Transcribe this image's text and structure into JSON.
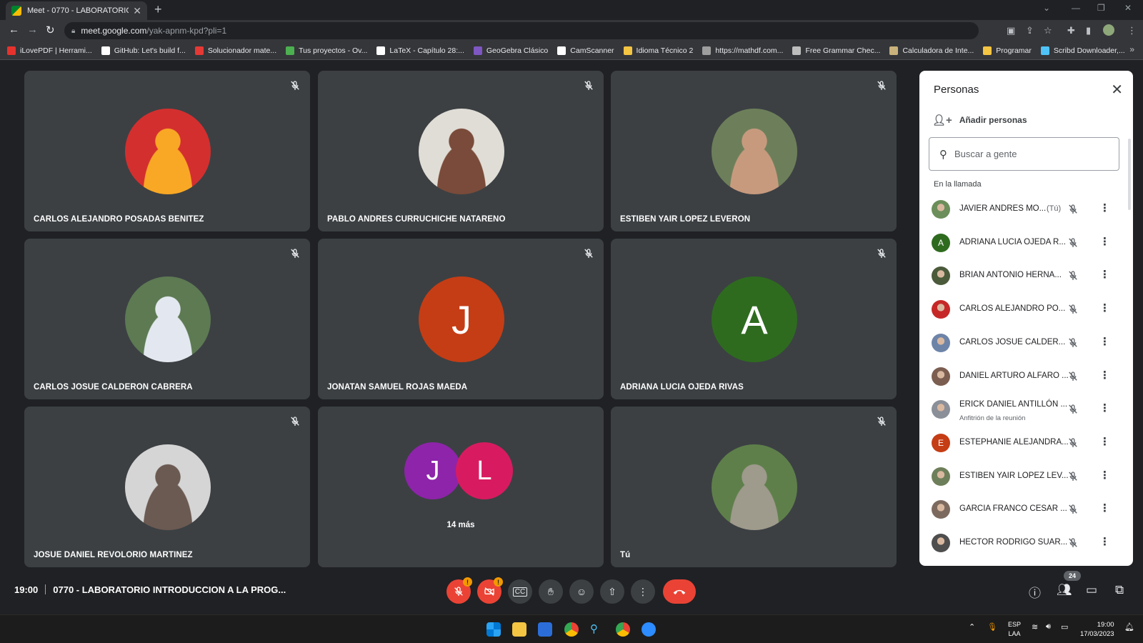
{
  "browser": {
    "tab_title": "Meet - 0770 - LABORATORIO INT",
    "url_host": "meet.google.com",
    "url_path": "/yak-apnm-kpd?pli=1",
    "bookmarks": [
      {
        "label": "iLovePDF | Herrami...",
        "color": "#e5322d"
      },
      {
        "label": "GitHub: Let's build f...",
        "color": "#ffffff"
      },
      {
        "label": "Solucionador mate...",
        "color": "#e53935"
      },
      {
        "label": "Tus proyectos - Ov...",
        "color": "#4caf50"
      },
      {
        "label": "LaTeX - Capítulo 28:...",
        "color": "#ffffff"
      },
      {
        "label": "GeoGebra Clásico",
        "color": "#7e57c2"
      },
      {
        "label": "CamScanner",
        "color": "#ffffff"
      },
      {
        "label": "Idioma Técnico 2",
        "color": "#f4c542"
      },
      {
        "label": "https://mathdf.com...",
        "color": "#9e9e9e"
      },
      {
        "label": "Free Grammar Chec...",
        "color": "#bdbdbd"
      },
      {
        "label": "Calculadora de Inte...",
        "color": "#c9b27c"
      },
      {
        "label": "Programar",
        "color": "#f4c542"
      },
      {
        "label": "Scribd Downloader,...",
        "color": "#4fc3f7"
      }
    ]
  },
  "tiles": [
    {
      "name": "CARLOS ALEJANDRO POSADAS BENITEZ",
      "avatar": "photo",
      "bg": "#d32f2f",
      "accent": "#f9a825"
    },
    {
      "name": "PABLO ANDRES CURRUCHICHE NATARENO",
      "avatar": "photo",
      "bg": "#e0ddd6",
      "accent": "#7a4b3a"
    },
    {
      "name": "ESTIBEN YAIR LOPEZ LEVERON",
      "avatar": "photo",
      "bg": "#6d7f5a",
      "accent": "#c79a7e"
    },
    {
      "name": "CARLOS JOSUE CALDERON CABRERA",
      "avatar": "photo",
      "bg": "#5d7a53",
      "accent": "#e3e8f0"
    },
    {
      "name": "JONATAN SAMUEL ROJAS MAEDA",
      "avatar": "letter",
      "letter": "J",
      "bg": "#c53d15"
    },
    {
      "name": "ADRIANA LUCIA OJEDA RIVAS",
      "avatar": "letter",
      "letter": "A",
      "bg": "#2e6b1f"
    },
    {
      "name": "JOSUE DANIEL REVOLORIO MARTINEZ",
      "avatar": "photo",
      "bg": "#d5d5d5",
      "accent": "#6b5a52"
    },
    {
      "name": "",
      "avatar": "group",
      "letters": [
        "J",
        "L"
      ],
      "colors": [
        "#8e24aa",
        "#d81b60"
      ],
      "more": "14 más"
    },
    {
      "name": "Tú",
      "avatar": "photo",
      "bg": "#5e7f4a",
      "accent": "#9e9a8c"
    }
  ],
  "panel": {
    "title": "Personas",
    "add_people": "Añadir personas",
    "search_placeholder": "Buscar a gente",
    "section": "En la llamada",
    "people": [
      {
        "name": "JAVIER ANDRES MO...",
        "tag": "(Tú)",
        "avatar": "photo",
        "color": "#6b8e5a"
      },
      {
        "name": "ADRIANA LUCIA OJEDA R...",
        "avatar": "letter",
        "letter": "A",
        "color": "#2e6b1f"
      },
      {
        "name": "BRIAN ANTONIO HERNA...",
        "avatar": "photo",
        "color": "#4a5a3a"
      },
      {
        "name": "CARLOS ALEJANDRO PO...",
        "avatar": "photo",
        "color": "#c62828"
      },
      {
        "name": "CARLOS JOSUE CALDER...",
        "avatar": "photo",
        "color": "#6d84a8"
      },
      {
        "name": "DANIEL ARTURO ALFARO ...",
        "avatar": "photo",
        "color": "#7b5e50"
      },
      {
        "name": "ERICK DANIEL ANTILLÓN ...",
        "sub": "Anfitrión de la reunión",
        "avatar": "photo",
        "color": "#8a8f98"
      },
      {
        "name": "ESTEPHANIE ALEJANDRA...",
        "avatar": "letter",
        "letter": "E",
        "color": "#c53d15"
      },
      {
        "name": "ESTIBEN YAIR LOPEZ LEV...",
        "avatar": "photo",
        "color": "#6d7f5a"
      },
      {
        "name": "GARCIA FRANCO CESAR ...",
        "avatar": "photo",
        "color": "#7d6a5f"
      },
      {
        "name": "HECTOR RODRIGO SUAR...",
        "avatar": "photo",
        "color": "#4e4e4e"
      }
    ]
  },
  "meeting": {
    "time": "19:00",
    "title": "0770 - LABORATORIO INTRODUCCION A LA PROG...",
    "participant_count": "24"
  },
  "taskbar": {
    "lang_1": "ESP",
    "lang_2": "LAA",
    "time": "19:00",
    "date": "17/03/2023"
  }
}
